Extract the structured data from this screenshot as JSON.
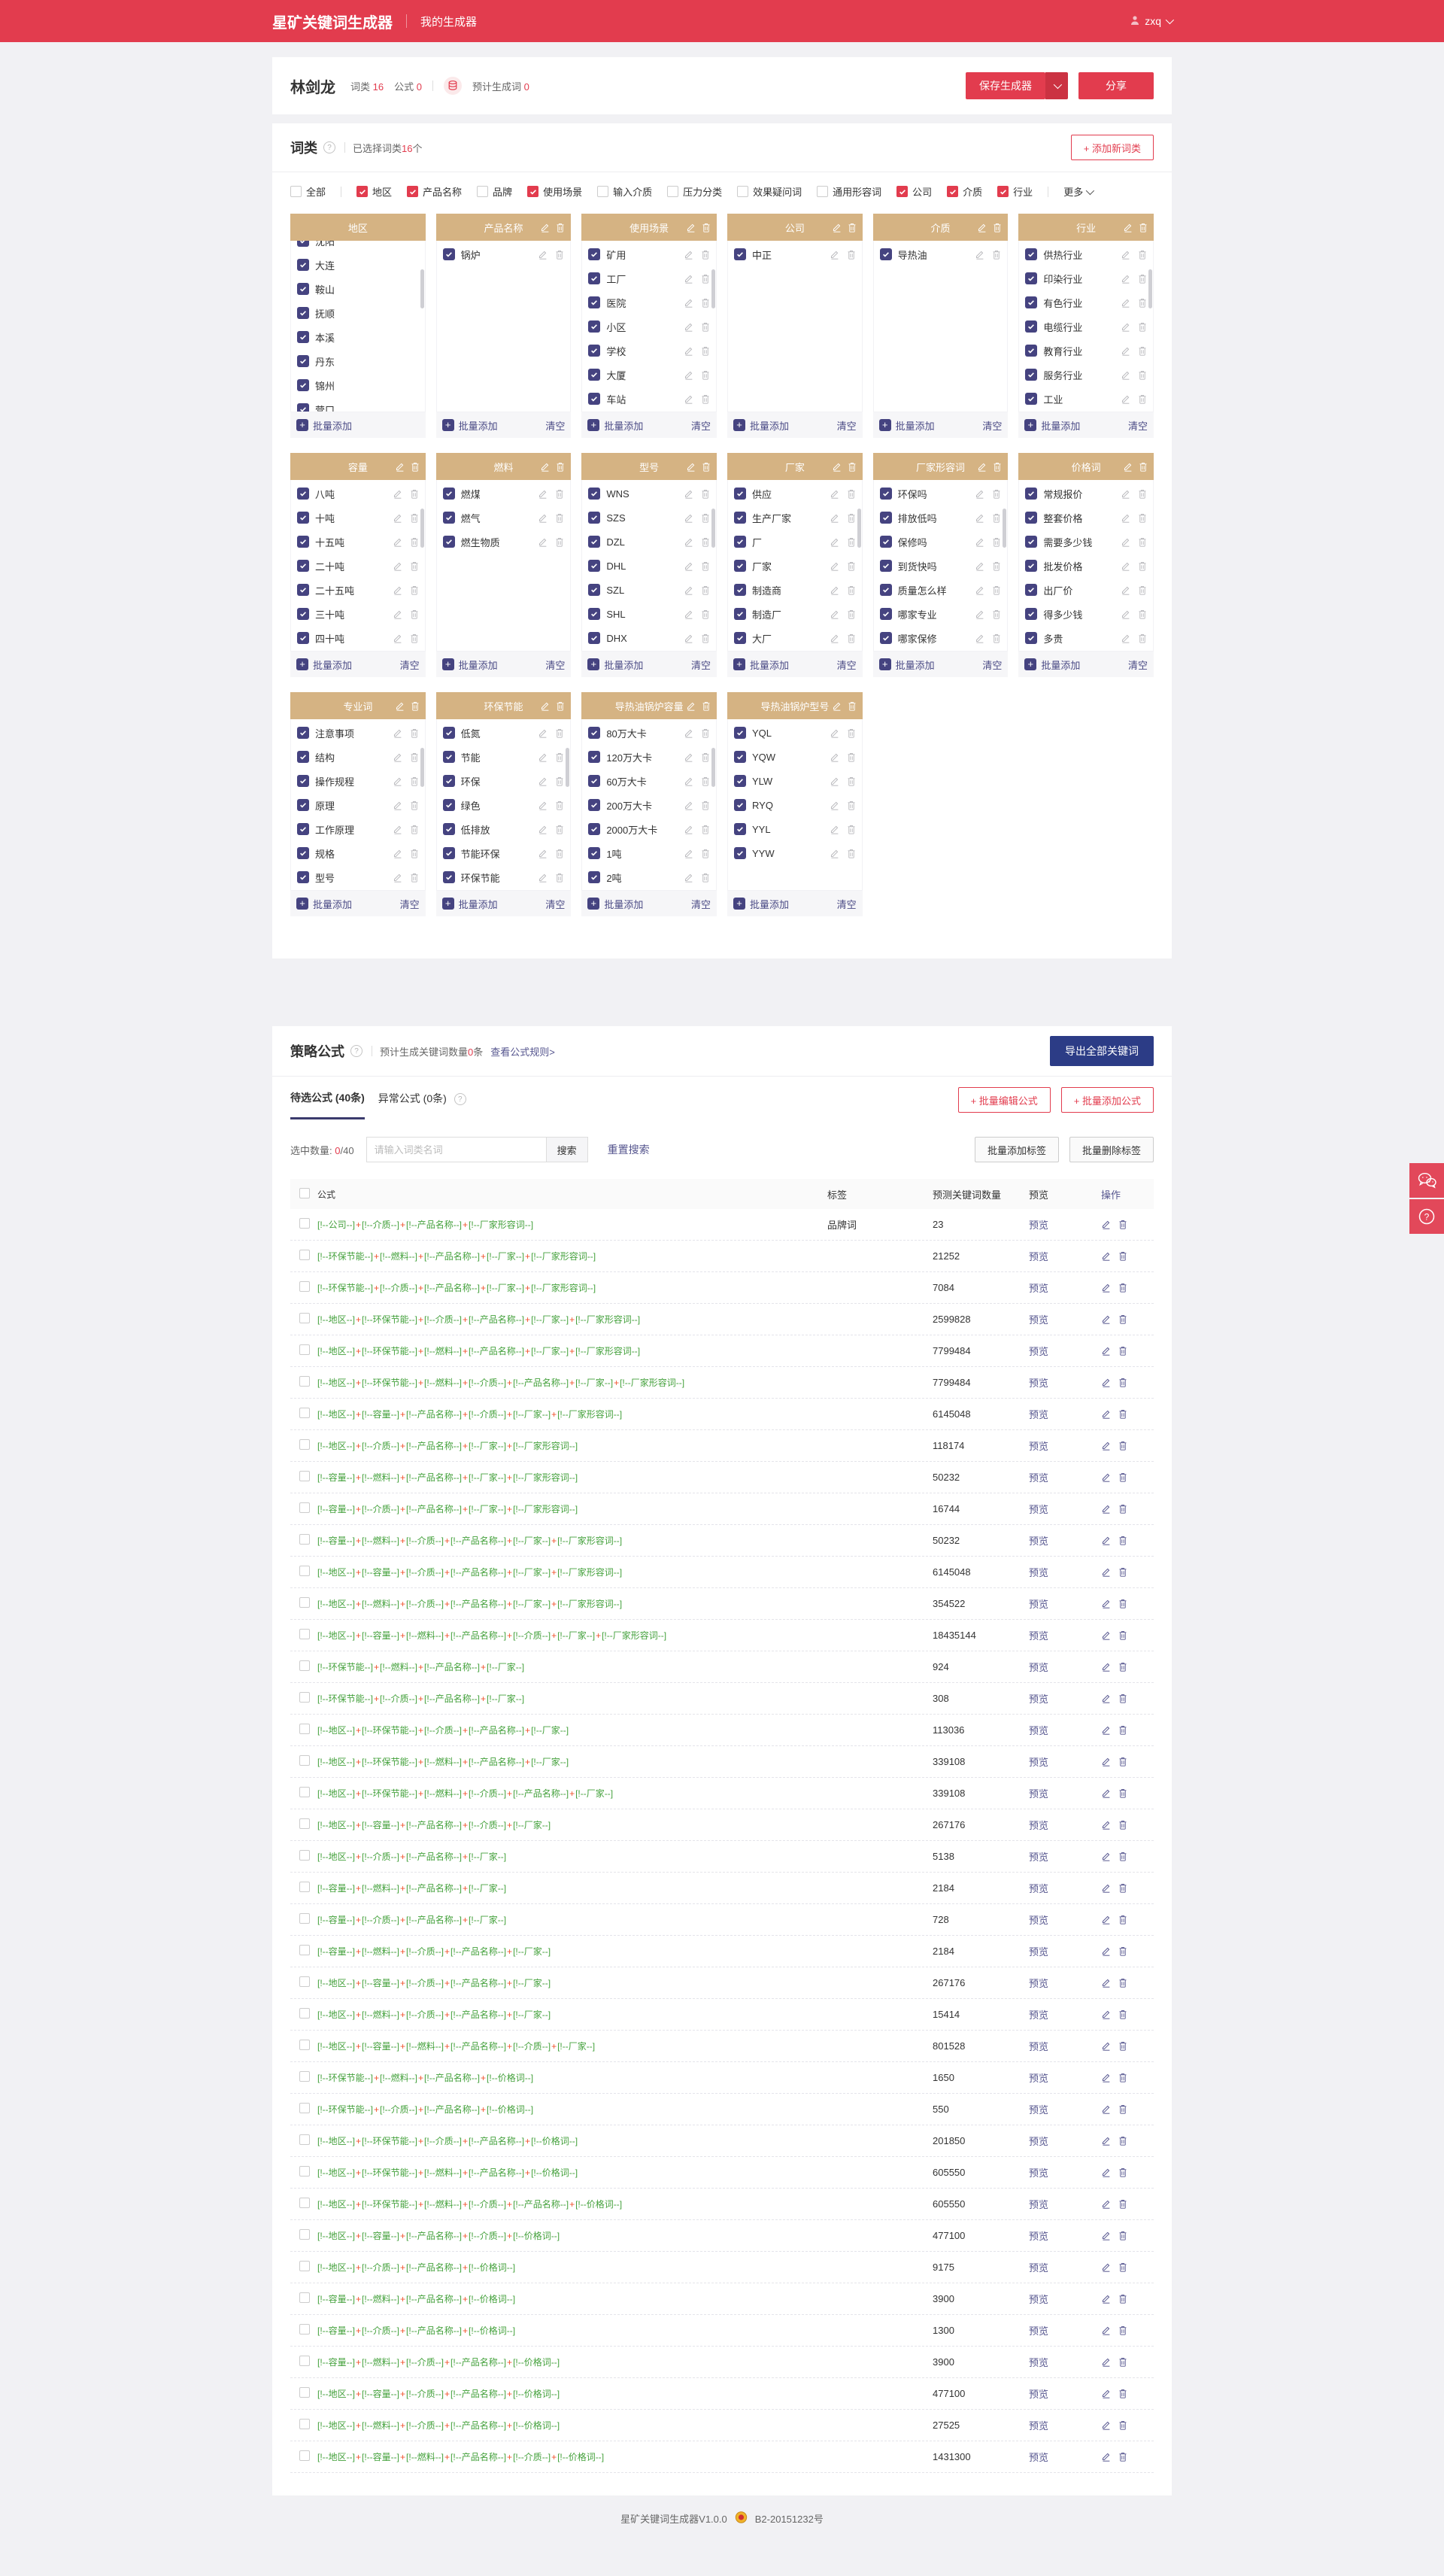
{
  "colors": {
    "accent_red": "#e23c4e",
    "card_header_tan": "#d5b383",
    "checkbox_indigo": "#454380",
    "link_indigo": "#55558e",
    "formula_green": "#44a13c",
    "formula_plus": "#f0532c",
    "export_navy": "#2c3c86"
  },
  "header": {
    "brand": "星矿关键词生成器",
    "nav": "我的生成器",
    "user": "zxq"
  },
  "generator": {
    "name": "林剑龙",
    "word_class_label": "词类",
    "word_class_count": "16",
    "formula_label": "公式",
    "formula_count": "0",
    "estimate_label": "预计生成词",
    "estimate_count": "0",
    "save_button": "保存生成器",
    "share_button": "分享"
  },
  "word_class": {
    "title": "词类",
    "selected_prefix": "已选择词类",
    "selected_count": "16",
    "selected_suffix": "个",
    "add_button": "+ 添加新词类",
    "more_label": "更多",
    "batch_add_label": "批量添加",
    "clear_label": "清空",
    "filters": [
      {
        "label": "全部",
        "checked": false,
        "divider_after": true
      },
      {
        "label": "地区",
        "checked": true
      },
      {
        "label": "产品名称",
        "checked": true
      },
      {
        "label": "品牌",
        "checked": false
      },
      {
        "label": "使用场景",
        "checked": true
      },
      {
        "label": "输入介质",
        "checked": false
      },
      {
        "label": "压力分类",
        "checked": false
      },
      {
        "label": "效果疑问词",
        "checked": false
      },
      {
        "label": "通用形容词",
        "checked": false
      },
      {
        "label": "公司",
        "checked": true
      },
      {
        "label": "介质",
        "checked": true
      },
      {
        "label": "行业",
        "checked": true,
        "divider_after": true
      }
    ],
    "cards": [
      {
        "title": "地区",
        "head_icons": false,
        "item_icons": false,
        "clear": false,
        "scrollbar": true,
        "cut_top": true,
        "items": [
          "沈阳",
          "大连",
          "鞍山",
          "抚顺",
          "本溪",
          "丹东",
          "锦州",
          "营口"
        ]
      },
      {
        "title": "产品名称",
        "head_icons": true,
        "item_icons": true,
        "clear": true,
        "scrollbar": false,
        "items": [
          "锅炉"
        ]
      },
      {
        "title": "使用场景",
        "head_icons": true,
        "item_icons": true,
        "clear": true,
        "scrollbar": true,
        "items": [
          "矿用",
          "工厂",
          "医院",
          "小区",
          "学校",
          "大厦",
          "车站"
        ]
      },
      {
        "title": "公司",
        "head_icons": true,
        "item_icons": true,
        "clear": true,
        "scrollbar": false,
        "items": [
          "中正"
        ]
      },
      {
        "title": "介质",
        "head_icons": true,
        "item_icons": true,
        "clear": true,
        "scrollbar": false,
        "items": [
          "导热油"
        ]
      },
      {
        "title": "行业",
        "head_icons": true,
        "item_icons": true,
        "clear": true,
        "scrollbar": true,
        "items": [
          "供热行业",
          "印染行业",
          "有色行业",
          "电缆行业",
          "教育行业",
          "服务行业",
          "工业"
        ]
      },
      {
        "title": "容量",
        "head_icons": true,
        "item_icons": true,
        "clear": true,
        "scrollbar": true,
        "items": [
          "八吨",
          "十吨",
          "十五吨",
          "二十吨",
          "二十五吨",
          "三十吨",
          "四十吨"
        ]
      },
      {
        "title": "燃料",
        "head_icons": true,
        "item_icons": true,
        "clear": true,
        "scrollbar": false,
        "items": [
          "燃煤",
          "燃气",
          "燃生物质"
        ]
      },
      {
        "title": "型号",
        "head_icons": true,
        "item_icons": true,
        "clear": true,
        "scrollbar": true,
        "items": [
          "WNS",
          "SZS",
          "DZL",
          "DHL",
          "SZL",
          "SHL",
          "DHX"
        ]
      },
      {
        "title": "厂家",
        "head_icons": true,
        "item_icons": true,
        "clear": true,
        "scrollbar": true,
        "items": [
          "供应",
          "生产厂家",
          "厂",
          "厂家",
          "制造商",
          "制造厂",
          "大厂"
        ]
      },
      {
        "title": "厂家形容词",
        "head_icons": true,
        "item_icons": true,
        "clear": true,
        "scrollbar": true,
        "items": [
          "环保吗",
          "排放低吗",
          "保修吗",
          "到货快吗",
          "质量怎么样",
          "哪家专业",
          "哪家保修"
        ]
      },
      {
        "title": "价格词",
        "head_icons": true,
        "item_icons": true,
        "clear": true,
        "scrollbar": false,
        "items": [
          "常规报价",
          "整套价格",
          "需要多少钱",
          "批发价格",
          "出厂价",
          "得多少钱",
          "多贵"
        ]
      },
      {
        "title": "专业词",
        "head_icons": true,
        "item_icons": true,
        "clear": true,
        "scrollbar": true,
        "items": [
          "注意事项",
          "结构",
          "操作规程",
          "原理",
          "工作原理",
          "规格",
          "型号"
        ]
      },
      {
        "title": "环保节能",
        "head_icons": true,
        "item_icons": true,
        "clear": true,
        "scrollbar": true,
        "items": [
          "低氮",
          "节能",
          "环保",
          "绿色",
          "低排放",
          "节能环保",
          "环保节能"
        ]
      },
      {
        "title": "导热油锅炉容量",
        "head_icons": true,
        "item_icons": true,
        "clear": true,
        "scrollbar": true,
        "items": [
          "80万大卡",
          "120万大卡",
          "60万大卡",
          "200万大卡",
          "2000万大卡",
          "1吨",
          "2吨"
        ]
      },
      {
        "title": "导热油锅炉型号",
        "head_icons": true,
        "item_icons": true,
        "clear": true,
        "scrollbar": false,
        "items": [
          "YQL",
          "YQW",
          "YLW",
          "RYQ",
          "YYL",
          "YYW"
        ]
      }
    ]
  },
  "strategy": {
    "title": "策略公式",
    "estimate_prefix": "预计生成关键词数量",
    "estimate_count": "0",
    "estimate_suffix": "条",
    "rules_link": "查看公式规则>",
    "export_button": "导出全部关键词",
    "tab_pending": "待选公式 (40条)",
    "tab_abnormal": "异常公式 (0条)",
    "batch_edit_button": "+ 批量编辑公式",
    "batch_add_button": "+ 批量添加公式",
    "selected_label": "选中数量:",
    "selected_zero": "0",
    "selected_total": "/40",
    "search_placeholder": "请输入词类名词",
    "search_button": "搜索",
    "reset_link": "重置搜索",
    "add_tag_button": "批量添加标签",
    "del_tag_button": "批量删除标签",
    "table": {
      "headers": {
        "formula": "公式",
        "tag": "标签",
        "count": "预测关键词数量",
        "preview": "预览",
        "ops": "操作"
      },
      "preview_label": "预览",
      "bracket_open": "[!--",
      "bracket_close": "--]",
      "joiner": "+",
      "rows": [
        {
          "parts": [
            "公司",
            "介质",
            "产品名称",
            "厂家形容词"
          ],
          "tag": "品牌词",
          "count": "23"
        },
        {
          "parts": [
            "环保节能",
            "燃料",
            "产品名称",
            "厂家",
            "厂家形容词"
          ],
          "tag": "",
          "count": "21252"
        },
        {
          "parts": [
            "环保节能",
            "介质",
            "产品名称",
            "厂家",
            "厂家形容词"
          ],
          "tag": "",
          "count": "7084"
        },
        {
          "parts": [
            "地区",
            "环保节能",
            "介质",
            "产品名称",
            "厂家",
            "厂家形容词"
          ],
          "tag": "",
          "count": "2599828"
        },
        {
          "parts": [
            "地区",
            "环保节能",
            "燃料",
            "产品名称",
            "厂家",
            "厂家形容词"
          ],
          "tag": "",
          "count": "7799484"
        },
        {
          "parts": [
            "地区",
            "环保节能",
            "燃料",
            "介质",
            "产品名称",
            "厂家",
            "厂家形容词"
          ],
          "tag": "",
          "count": "7799484"
        },
        {
          "parts": [
            "地区",
            "容量",
            "产品名称",
            "介质",
            "厂家",
            "厂家形容词"
          ],
          "tag": "",
          "count": "6145048"
        },
        {
          "parts": [
            "地区",
            "介质",
            "产品名称",
            "厂家",
            "厂家形容词"
          ],
          "tag": "",
          "count": "118174"
        },
        {
          "parts": [
            "容量",
            "燃料",
            "产品名称",
            "厂家",
            "厂家形容词"
          ],
          "tag": "",
          "count": "50232"
        },
        {
          "parts": [
            "容量",
            "介质",
            "产品名称",
            "厂家",
            "厂家形容词"
          ],
          "tag": "",
          "count": "16744"
        },
        {
          "parts": [
            "容量",
            "燃料",
            "介质",
            "产品名称",
            "厂家",
            "厂家形容词"
          ],
          "tag": "",
          "count": "50232"
        },
        {
          "parts": [
            "地区",
            "容量",
            "介质",
            "产品名称",
            "厂家",
            "厂家形容词"
          ],
          "tag": "",
          "count": "6145048"
        },
        {
          "parts": [
            "地区",
            "燃料",
            "介质",
            "产品名称",
            "厂家",
            "厂家形容词"
          ],
          "tag": "",
          "count": "354522"
        },
        {
          "parts": [
            "地区",
            "容量",
            "燃料",
            "产品名称",
            "介质",
            "厂家",
            "厂家形容词"
          ],
          "tag": "",
          "count": "18435144"
        },
        {
          "parts": [
            "环保节能",
            "燃料",
            "产品名称",
            "厂家"
          ],
          "tag": "",
          "count": "924"
        },
        {
          "parts": [
            "环保节能",
            "介质",
            "产品名称",
            "厂家"
          ],
          "tag": "",
          "count": "308"
        },
        {
          "parts": [
            "地区",
            "环保节能",
            "介质",
            "产品名称",
            "厂家"
          ],
          "tag": "",
          "count": "113036"
        },
        {
          "parts": [
            "地区",
            "环保节能",
            "燃料",
            "产品名称",
            "厂家"
          ],
          "tag": "",
          "count": "339108"
        },
        {
          "parts": [
            "地区",
            "环保节能",
            "燃料",
            "介质",
            "产品名称",
            "厂家"
          ],
          "tag": "",
          "count": "339108"
        },
        {
          "parts": [
            "地区",
            "容量",
            "产品名称",
            "介质",
            "厂家"
          ],
          "tag": "",
          "count": "267176"
        },
        {
          "parts": [
            "地区",
            "介质",
            "产品名称",
            "厂家"
          ],
          "tag": "",
          "count": "5138"
        },
        {
          "parts": [
            "容量",
            "燃料",
            "产品名称",
            "厂家"
          ],
          "tag": "",
          "count": "2184"
        },
        {
          "parts": [
            "容量",
            "介质",
            "产品名称",
            "厂家"
          ],
          "tag": "",
          "count": "728"
        },
        {
          "parts": [
            "容量",
            "燃料",
            "介质",
            "产品名称",
            "厂家"
          ],
          "tag": "",
          "count": "2184"
        },
        {
          "parts": [
            "地区",
            "容量",
            "介质",
            "产品名称",
            "厂家"
          ],
          "tag": "",
          "count": "267176"
        },
        {
          "parts": [
            "地区",
            "燃料",
            "介质",
            "产品名称",
            "厂家"
          ],
          "tag": "",
          "count": "15414"
        },
        {
          "parts": [
            "地区",
            "容量",
            "燃料",
            "产品名称",
            "介质",
            "厂家"
          ],
          "tag": "",
          "count": "801528"
        },
        {
          "parts": [
            "环保节能",
            "燃料",
            "产品名称",
            "价格词"
          ],
          "tag": "",
          "count": "1650"
        },
        {
          "parts": [
            "环保节能",
            "介质",
            "产品名称",
            "价格词"
          ],
          "tag": "",
          "count": "550"
        },
        {
          "parts": [
            "地区",
            "环保节能",
            "介质",
            "产品名称",
            "价格词"
          ],
          "tag": "",
          "count": "201850"
        },
        {
          "parts": [
            "地区",
            "环保节能",
            "燃料",
            "产品名称",
            "价格词"
          ],
          "tag": "",
          "count": "605550"
        },
        {
          "parts": [
            "地区",
            "环保节能",
            "燃料",
            "介质",
            "产品名称",
            "价格词"
          ],
          "tag": "",
          "count": "605550"
        },
        {
          "parts": [
            "地区",
            "容量",
            "产品名称",
            "介质",
            "价格词"
          ],
          "tag": "",
          "count": "477100"
        },
        {
          "parts": [
            "地区",
            "介质",
            "产品名称",
            "价格词"
          ],
          "tag": "",
          "count": "9175"
        },
        {
          "parts": [
            "容量",
            "燃料",
            "产品名称",
            "价格词"
          ],
          "tag": "",
          "count": "3900"
        },
        {
          "parts": [
            "容量",
            "介质",
            "产品名称",
            "价格词"
          ],
          "tag": "",
          "count": "1300"
        },
        {
          "parts": [
            "容量",
            "燃料",
            "介质",
            "产品名称",
            "价格词"
          ],
          "tag": "",
          "count": "3900"
        },
        {
          "parts": [
            "地区",
            "容量",
            "介质",
            "产品名称",
            "价格词"
          ],
          "tag": "",
          "count": "477100"
        },
        {
          "parts": [
            "地区",
            "燃料",
            "介质",
            "产品名称",
            "价格词"
          ],
          "tag": "",
          "count": "27525"
        },
        {
          "parts": [
            "地区",
            "容量",
            "燃料",
            "产品名称",
            "介质",
            "价格词"
          ],
          "tag": "",
          "count": "1431300"
        }
      ]
    }
  },
  "footer": {
    "version": "星矿关键词生成器V1.0.0",
    "icp": "B2-20151232号"
  }
}
